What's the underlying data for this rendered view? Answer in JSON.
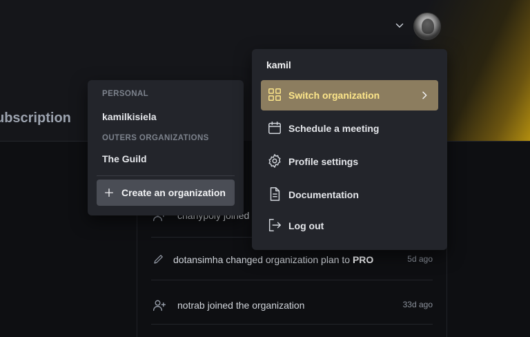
{
  "header": {
    "page_heading": "ubscription",
    "accent_color": "#b18d0f"
  },
  "activity": {
    "rows": [
      {
        "icon": "user-plus-icon",
        "text": "charlypoly joined",
        "bold": "",
        "time": ""
      },
      {
        "icon": "pencil-icon",
        "text": "dotansimha changed organization plan to ",
        "bold": "PRO",
        "time": "5d ago"
      },
      {
        "icon": "user-plus-icon",
        "text": "notrab joined the organization",
        "bold": "",
        "time": "33d ago"
      }
    ]
  },
  "org_menu": {
    "personal_label": "PERSONAL",
    "personal_item": "kamilkisiela",
    "outers_label": "OUTERS ORGANIZATIONS",
    "outers_item": "The Guild",
    "create_label": "Create an organization"
  },
  "user_menu": {
    "username": "kamil",
    "items": [
      {
        "label": "Switch organization",
        "icon": "grid-icon"
      },
      {
        "label": "Schedule a meeting",
        "icon": "calendar-icon"
      },
      {
        "label": "Profile settings",
        "icon": "gear-icon"
      },
      {
        "label": "Documentation",
        "icon": "document-icon"
      },
      {
        "label": "Log out",
        "icon": "logout-icon"
      }
    ]
  }
}
